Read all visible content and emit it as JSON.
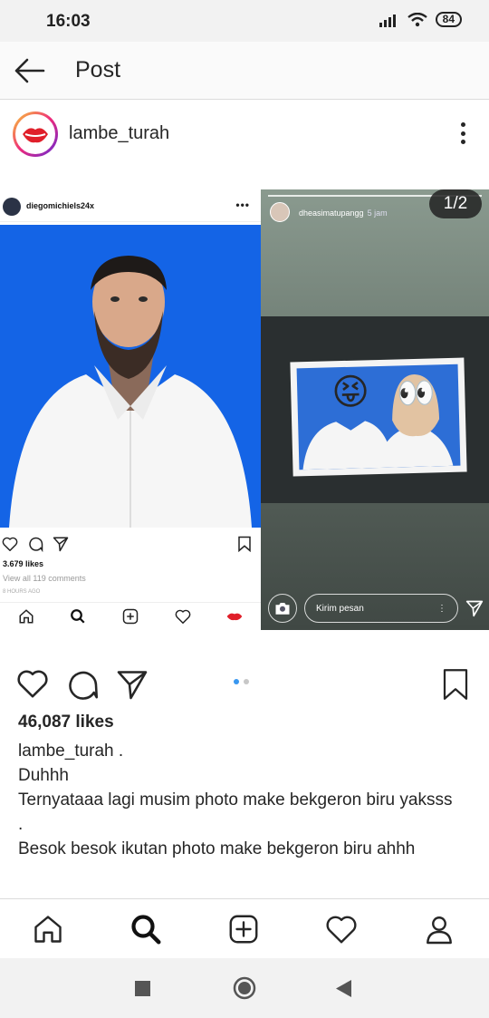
{
  "status_bar": {
    "time": "16:03",
    "battery": "84",
    "icons": [
      "signal-icon",
      "wifi-icon",
      "battery-icon"
    ]
  },
  "header": {
    "back_icon": "arrow-left-icon",
    "title": "Post"
  },
  "post": {
    "username": "lambe_turah",
    "avatar_icon": "lips-logo",
    "more_icon": "vertical-dots-icon",
    "page_indicator": "1/2",
    "carousel_dots": 2,
    "carousel_active_index": 0,
    "likes": "46,087 likes",
    "caption_user": "lambe_turah",
    "caption_lines": [
      " .",
      "Duhhh",
      "Ternyataaa lagi musim photo make bekgeron biru yaksss",
      ".",
      "Besok besok ikutan photo make bekgeron biru ahhh"
    ]
  },
  "embedded_left": {
    "username": "diegomichiels24x",
    "more": "•••",
    "likes": "3.679 likes",
    "comments": "View all 119 comments",
    "time": "8 HOURS AGO",
    "photo_bg": "#1464e6"
  },
  "embedded_right": {
    "username": "dheasimatupangg",
    "time": "5 jam",
    "message_placeholder": "Kirim pesan",
    "emoji_left": "😝",
    "emoji_right": "👀"
  },
  "actions": {
    "like_icon": "heart-icon",
    "comment_icon": "comment-icon",
    "share_icon": "send-icon",
    "save_icon": "bookmark-icon"
  },
  "bottom_nav": [
    "home-icon",
    "search-icon",
    "add-icon",
    "heart-icon",
    "profile-icon"
  ],
  "system_nav": [
    "square-icon",
    "circle-icon",
    "back-triangle-icon"
  ],
  "colors": {
    "accent_blue": "#3897f0",
    "text": "#262626",
    "photo_blue": "#1464e6"
  }
}
